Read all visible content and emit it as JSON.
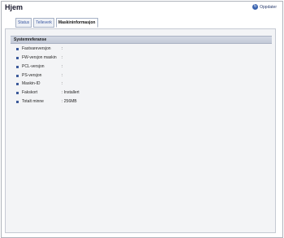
{
  "header": {
    "title": "Hjem",
    "refresh_label": "Oppdater"
  },
  "tabs": [
    {
      "label": "Status",
      "active": false
    },
    {
      "label": "Telleverk",
      "active": false
    },
    {
      "label": "Maskininformasjon",
      "active": true
    }
  ],
  "section": {
    "title": "Systemreferanse",
    "rows": [
      {
        "label": "Fastvareversjon",
        "value": ":"
      },
      {
        "label": "FW-versjon maskin",
        "value": ":"
      },
      {
        "label": "PCL-versjon",
        "value": ":"
      },
      {
        "label": "PS-versjon",
        "value": ":"
      },
      {
        "label": "Maskin-ID",
        "value": ":"
      },
      {
        "label": "Fakskort",
        "value": ": Installert"
      },
      {
        "label": "Totalt minne",
        "value": ": 256MB"
      }
    ]
  },
  "icons": {
    "refresh": "refresh-icon",
    "bullet": "square-bullet-icon"
  }
}
